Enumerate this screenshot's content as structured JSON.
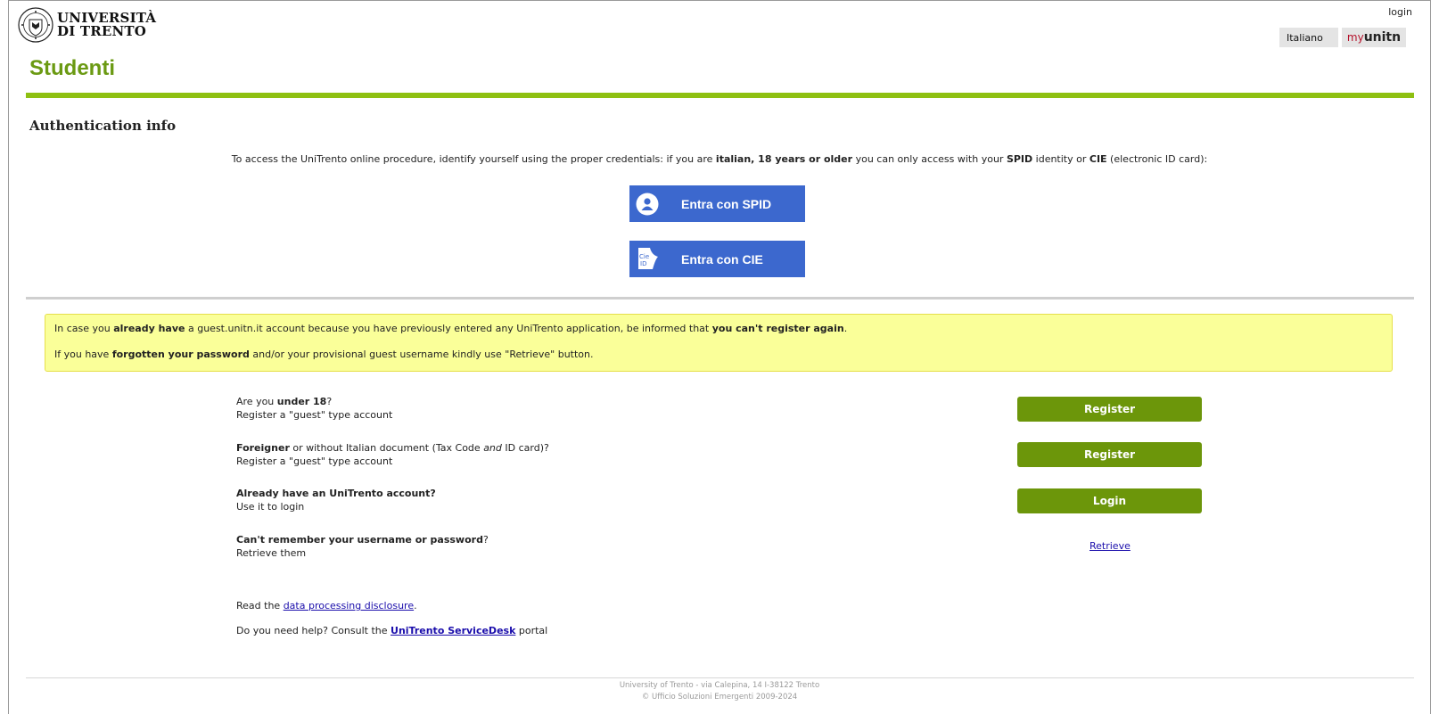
{
  "header": {
    "logo_line1": "UNIVERSITÀ",
    "logo_line2": "DI TRENTO",
    "login_link": "login",
    "language": "Italiano",
    "myunitn_my": "my",
    "myunitn_unitn": "unitn",
    "page_title": "Studenti"
  },
  "auth": {
    "section_title": "Authentication info",
    "intro_pre": "To access the UniTrento online procedure, identify yourself using the proper credentials: if you are ",
    "intro_bold1": "italian, 18 years or older",
    "intro_mid": " you can only access with your ",
    "intro_bold2": "SPID",
    "intro_mid2": " identity or ",
    "intro_bold3": "CIE",
    "intro_post": " (electronic ID card):",
    "spid_label": "Entra con SPID",
    "cie_label": "Entra con CIE",
    "cie_icon_text1": "Cie",
    "cie_icon_text2": "ID"
  },
  "notice": {
    "line1_pre": "In case you ",
    "line1_bold1": "already have",
    "line1_mid": " a guest.unitn.it account because you have previously entered any UniTrento application, be informed that ",
    "line1_bold2": "you can't register again",
    "line1_post": ".",
    "line2_pre": "If you have ",
    "line2_bold": "forgotten your password",
    "line2_post": " and/or your provisional guest username kindly use \"Retrieve\" button."
  },
  "options": {
    "under18": {
      "q_pre": "Are you ",
      "q_bold": "under 18",
      "q_post": "?",
      "sub": "Register a \"guest\" type account",
      "button": "Register"
    },
    "foreigner": {
      "q_bold": "Foreigner",
      "q_pre": " or without Italian document (Tax Code ",
      "q_em": "and",
      "q_post": " ID card)?",
      "sub": "Register a \"guest\" type account",
      "button": "Register"
    },
    "account": {
      "q_bold": "Already have an UniTrento account?",
      "sub": "Use it to login",
      "button": "Login"
    },
    "forgot": {
      "q_bold": "Can't remember your username or password",
      "q_post": "?",
      "sub": "Retrieve them",
      "link": "Retrieve"
    }
  },
  "bottom": {
    "privacy_pre": "Read the ",
    "privacy_link": "data processing disclosure",
    "privacy_post": ".",
    "help_pre": "Do you need help? Consult the ",
    "help_link": "UniTrento ServiceDesk",
    "help_post": " portal"
  },
  "footer": {
    "line1": "University of Trento - via Calepina, 14 I-38122 Trento",
    "line2": "© Ufficio Soluzioni Emergenti 2009-2024"
  },
  "colors": {
    "brand_green": "#6b9a13",
    "rule_green": "#8ec012",
    "button_green": "#6c960a",
    "id_button_blue": "#3c68ce",
    "notice_yellow": "#faff99"
  },
  "icons": [
    "university-seal-icon",
    "spid-user-icon",
    "cie-id-icon"
  ]
}
